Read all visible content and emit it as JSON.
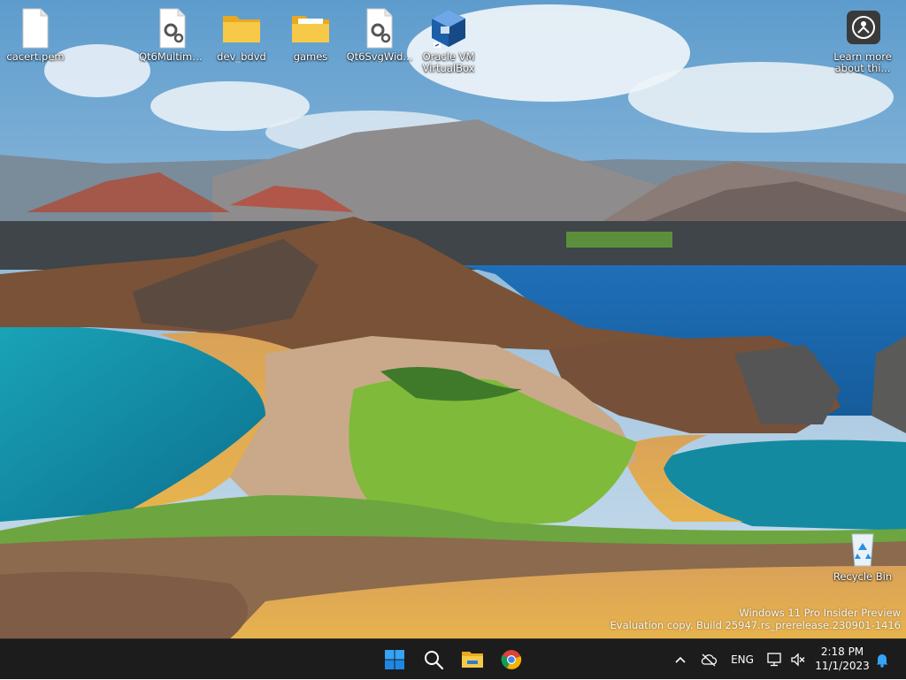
{
  "desktop": {
    "icons": [
      {
        "label": "cacert.pem",
        "icon": "file-icon"
      },
      {
        "label": "Qt6Multime...",
        "icon": "settings-file-icon"
      },
      {
        "label": "dev_bdvd",
        "icon": "folder-icon"
      },
      {
        "label": "games",
        "icon": "folder-icon"
      },
      {
        "label": "Qt6SvgWid...",
        "icon": "settings-file-icon"
      },
      {
        "label": "Oracle VM VirtualBox",
        "icon": "virtualbox-icon"
      },
      {
        "label": "Learn more about thi...",
        "icon": "learn-more-icon"
      },
      {
        "label": "Recycle Bin",
        "icon": "recycle-bin-icon"
      }
    ]
  },
  "watermark": {
    "line1": "Windows 11 Pro Insider Preview",
    "line2": "Evaluation copy. Build 25947.rs_prerelease.230901-1416"
  },
  "taskbar": {
    "pinned": [
      "start-icon",
      "search-icon",
      "file-explorer-icon",
      "chrome-icon"
    ],
    "tray": {
      "language": "ENG",
      "time": "2:18 PM",
      "date": "11/1/2023"
    }
  },
  "colors": {
    "taskbar_bg": "#1c1c1c",
    "start_blue": "#0a84ff",
    "folder_yellow": "#f4c542"
  }
}
